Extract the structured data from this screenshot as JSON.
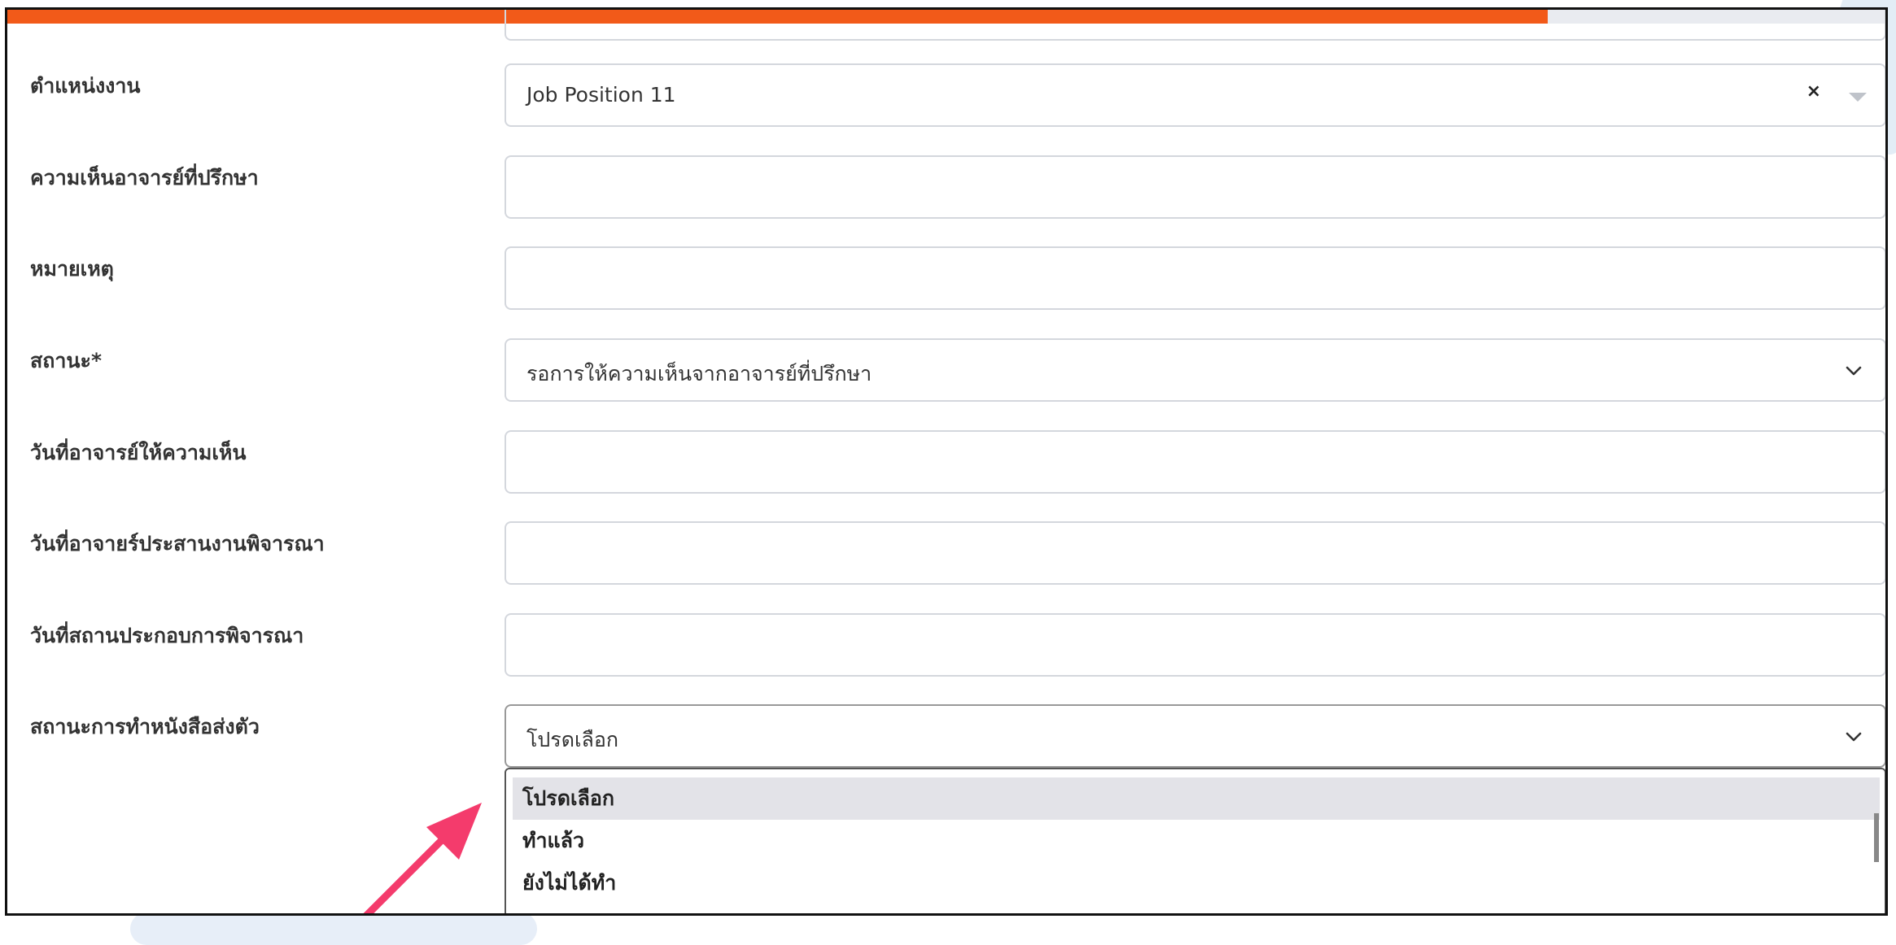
{
  "progress": {
    "fraction": 0.82,
    "color": "#f25a19"
  },
  "fields": [
    {
      "label": "ตำแหน่งงาน",
      "value": "Job Position 11",
      "type": "select-clear"
    },
    {
      "label": "ความเห็นอาจารย์ที่ปรึกษา",
      "value": "",
      "type": "text"
    },
    {
      "label": "หมายเหตุ",
      "value": "",
      "type": "text"
    },
    {
      "label": "สถานะ*",
      "value": "รอการให้ความเห็นจากอาจารย์ที่ปรึกษา",
      "type": "select"
    },
    {
      "label": "วันที่อาจารย์ให้ความเห็น",
      "value": "",
      "type": "text"
    },
    {
      "label": "วันที่อาจายร์ประสานงานพิจารณา",
      "value": "",
      "type": "text"
    },
    {
      "label": "วันที่สถานประกอบการพิจารณา",
      "value": "",
      "type": "text"
    },
    {
      "label": "สถานะการทำหนังสือส่งตัว",
      "value": "โปรดเลือก",
      "type": "select"
    }
  ],
  "dropdown": {
    "options": [
      "โปรดเลือก",
      "ทำแล้ว",
      "ยังไม่ได้ทำ"
    ],
    "selected_index": 0
  },
  "icons": {
    "clear": "clear-x-icon",
    "caret": "caret-down-icon",
    "chevron": "chevron-down-icon",
    "annotation_arrow_color": "#f43b6c"
  }
}
